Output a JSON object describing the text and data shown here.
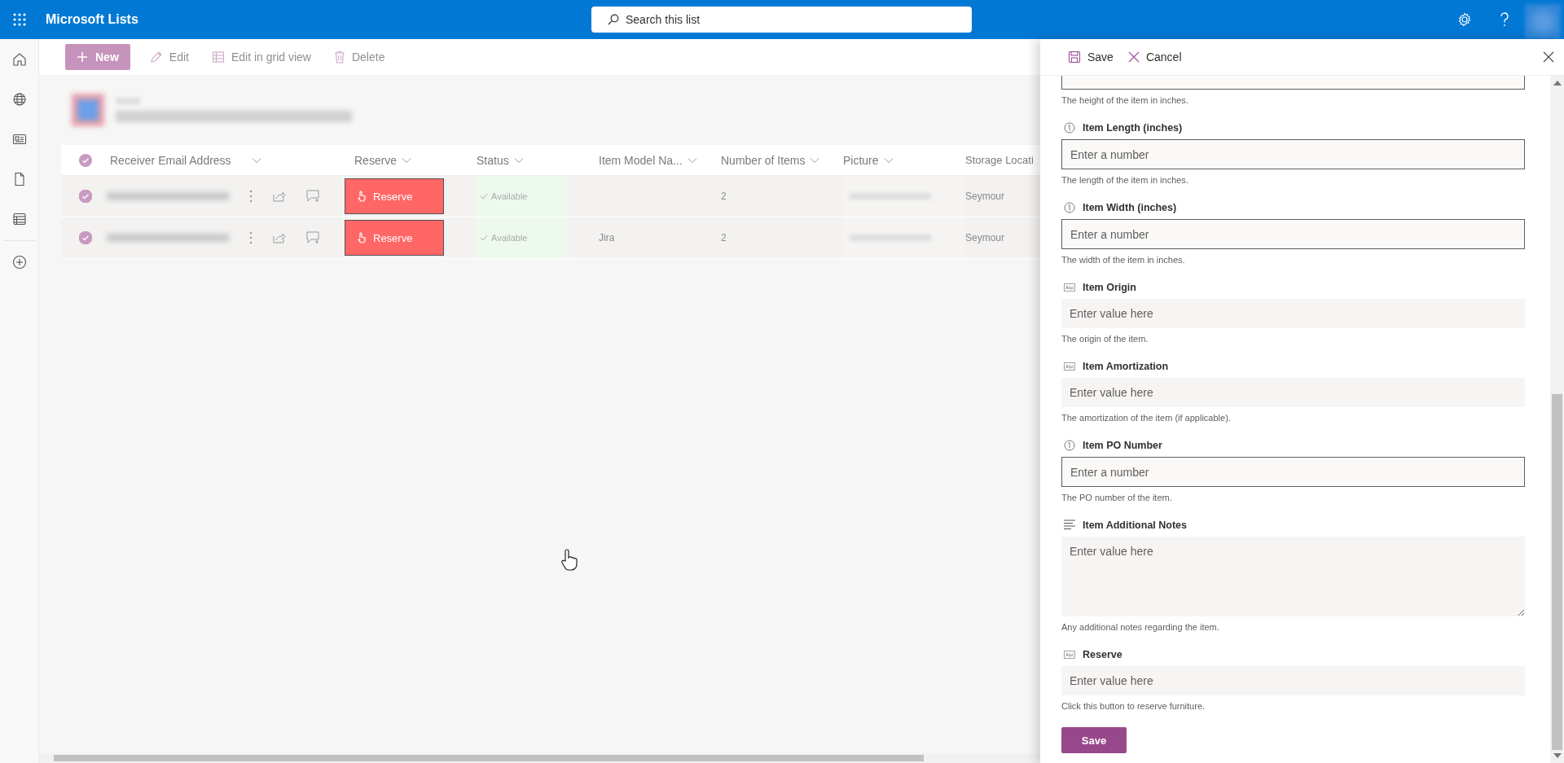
{
  "app": {
    "title": "Microsoft Lists"
  },
  "search": {
    "placeholder": "Search this list"
  },
  "commands": [
    {
      "kind": "new",
      "label": "New"
    },
    {
      "kind": "edit",
      "label": "Edit"
    },
    {
      "kind": "grid",
      "label": "Edit in grid view"
    },
    {
      "kind": "delete",
      "label": "Delete"
    }
  ],
  "columns": [
    "Receiver Email Address",
    "Reserve",
    "Status",
    "Item Model Na...",
    "Number of Items",
    "Picture",
    "Storage Locati"
  ],
  "rows": [
    {
      "selected": true,
      "reserve": "Reserve",
      "status": "Available",
      "model": "",
      "count": "2",
      "location": "Seymour"
    },
    {
      "selected": true,
      "reserve": "Reserve",
      "status": "Available",
      "model": "Jira",
      "count": "2",
      "location": "Seymour"
    }
  ],
  "panel": {
    "actions": [
      {
        "kind": "save",
        "label": "Save"
      },
      {
        "kind": "cancel",
        "label": "Cancel"
      }
    ],
    "cut_field": {
      "description": "The height of the item in inches."
    },
    "fields": [
      {
        "kind": "number",
        "label": "Item Length (inches)",
        "placeholder": "Enter a number",
        "description": "The length of the item in inches."
      },
      {
        "kind": "number",
        "label": "Item Width (inches)",
        "placeholder": "Enter a number",
        "description": "The width of the item in inches."
      },
      {
        "kind": "text",
        "label": "Item Origin",
        "placeholder": "Enter value here",
        "description": "The origin of the item."
      },
      {
        "kind": "text",
        "label": "Item Amortization",
        "placeholder": "Enter value here",
        "description": "The amortization of the item (if applicable)."
      },
      {
        "kind": "number",
        "label": "Item PO Number",
        "placeholder": "Enter a number",
        "description": "The PO number of the item."
      },
      {
        "kind": "note",
        "label": "Item Additional Notes",
        "placeholder": "Enter value here",
        "description": "Any additional notes regarding the item."
      },
      {
        "kind": "text",
        "label": "Reserve",
        "placeholder": "Enter value here",
        "description": "Click this button to reserve furniture."
      }
    ],
    "submit": "Save"
  }
}
